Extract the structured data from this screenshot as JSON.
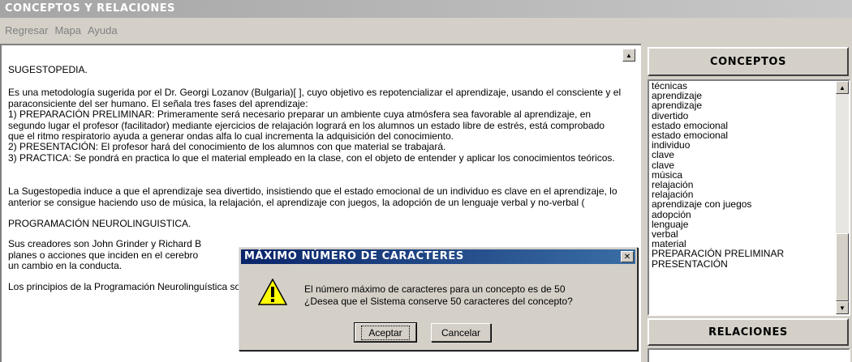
{
  "window": {
    "title": "CONCEPTOS Y RELACIONES"
  },
  "menu": [
    "Regresar",
    "Mapa",
    "Ayuda"
  ],
  "document": {
    "paragraphs": [
      "SUGESTOPEDIA.",
      "Es una metodología sugerida por el Dr. Georgi Lozanov  (Bulgaria)[  ], cuyo objetivo es repotencializar el aprendizaje, usando el consciente y el paraconsiciente del ser humano. El señala tres fases del aprendizaje:\n1) PREPARACIÓN PRELIMINAR: Primeramente será necesario preparar un ambiente cuya atmósfera sea favorable al aprendizaje, en segundo lugar el profesor (facilitador) mediante ejercicios de relajación  logrará  en los alumnos un estado libre de estrés, está comprobado que el ritmo respiratorio ayuda a generar ondas alfa lo cual incrementa la adquisición del conocimiento.\n2) PRESENTACIÓN: El profesor  hará del conocimiento de los alumnos con que material se trabajará.\n3) PRACTICA: Se pondrá en practica lo que el material empleado en la clase, con el objeto de entender y aplicar los conocimientos teóricos.",
      "La Sugestopedia induce a que el aprendizaje sea divertido, insistiendo que el estado emocional de un individuo es clave en el aprendizaje,  lo anterior se consigue haciendo uso de música, la relajación, el aprendizaje con juegos, la adopción de un lenguaje verbal y no-verbal (",
      "PROGRAMACIÓN NEUROLINGUISTICA.",
      "Sus creadores son John Grinder y Richard B\nplanes o acciones que inciden en el cerebro\nun cambio en la conducta.",
      "Los principios de la Programación Neurolinguística  son[  ]:"
    ]
  },
  "conceptos": {
    "header": "CONCEPTOS",
    "items": [
      "técnicas",
      "aprendizaje",
      "aprendizaje",
      "divertido",
      "estado emocional",
      "estado emocional",
      "individuo",
      "clave",
      "clave",
      "música",
      "relajación",
      "relajación",
      "aprendizaje con juegos",
      "adopción",
      "lenguaje",
      "verbal",
      "material",
      "PREPARACIÓN PRELIMINAR",
      "PRESENTACIÓN"
    ]
  },
  "relaciones": {
    "header": "RELACIONES"
  },
  "dialog": {
    "title": "MÁXIMO NÚMERO DE CARACTERES",
    "message_line1": "El número máximo de caracteres para un concepto es de 50",
    "message_line2": "¿Desea que el Sistema conserve 50 caracteres del concepto?",
    "accept_label": "Aceptar",
    "cancel_label": "Cancelar",
    "close_glyph": "✕",
    "icon": "warning-icon"
  },
  "colors": {
    "dialog_title_bg": "#0a246a",
    "window_bg": "#d4d0c8",
    "warning_yellow": "#ffff00"
  }
}
